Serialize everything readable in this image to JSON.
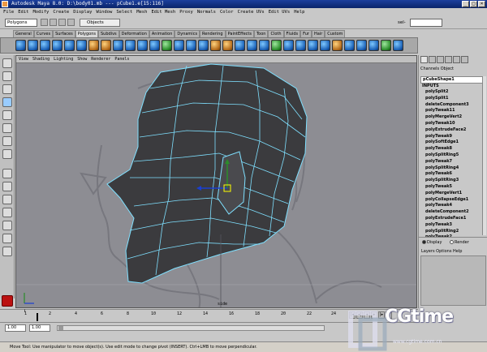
{
  "app": {
    "title": "Autodesk Maya 8.0: D:\\body01.mb  ---  pCube1.e[15:116]",
    "window_buttons": [
      "_",
      "□",
      "×"
    ]
  },
  "menubar": [
    "File",
    "Edit",
    "Modify",
    "Create",
    "Display",
    "Window",
    "Select",
    "Mesh",
    "Edit Mesh",
    "Proxy",
    "Normals",
    "Color",
    "Create UVs",
    "Edit UVs",
    "Help"
  ],
  "status": {
    "mode": "Polygons",
    "object_mode": "Objects",
    "sel_label": "sel-"
  },
  "shelf_tabs": [
    "General",
    "Curves",
    "Surfaces",
    "Polygons",
    "Subdivs",
    "Deformation",
    "Animation",
    "Dynamics",
    "Rendering",
    "PaintEffects",
    "Toon",
    "Cloth",
    "Fluids",
    "Fur",
    "Hair",
    "Custom"
  ],
  "shelf_active_tab": "Polygons",
  "viewport": {
    "menu": [
      "View",
      "Shading",
      "Lighting",
      "Show",
      "Renderer",
      "Panels"
    ],
    "camera_label": "side"
  },
  "channel_box": {
    "menu": [
      "Channels",
      "Object"
    ],
    "selected_node": "pCubeShape1",
    "inputs_label": "INPUTS",
    "history": [
      "polySplit2",
      "polySplit1",
      "deleteComponent3",
      "polyTweak11",
      "polyMergeVert2",
      "polyTweak10",
      "polyExtrudeFace2",
      "polyTweak9",
      "polySoftEdge1",
      "polyTweak8",
      "polySplitRing5",
      "polyTweak7",
      "polySplitRing4",
      "polyTweak6",
      "polySplitRing3",
      "polyTweak5",
      "polyMergeVert1",
      "polyCollapseEdge1",
      "polyTweak4",
      "deleteComponent2",
      "polyExtrudeFace1",
      "polyTweak3",
      "polySplitRing2",
      "polyTweak2"
    ]
  },
  "layers": {
    "display_label": "Display",
    "render_label": "Render",
    "menu": [
      "Layers",
      "Options",
      "Help"
    ]
  },
  "time": {
    "ticks": [
      "1",
      "2",
      "4",
      "6",
      "8",
      "10",
      "12",
      "14",
      "16",
      "18",
      "20",
      "22",
      "24"
    ],
    "current_frame": 1,
    "range_start": "1.00",
    "range_inner_start": "1.00"
  },
  "helpline": "Move Tool: Use manipulator to move object(s). Use edit mode to change pivot (INSERT). Ctrl+LMB to move perpendicular.",
  "watermark": {
    "text": "CGtime",
    "url": "www.cgtime.com.cn"
  },
  "colors": {
    "title_bar": "#0a246a",
    "viewport_bg": "#8d8d93",
    "wireframe": "#7fe0ff",
    "mesh": "#3b3b3e"
  }
}
